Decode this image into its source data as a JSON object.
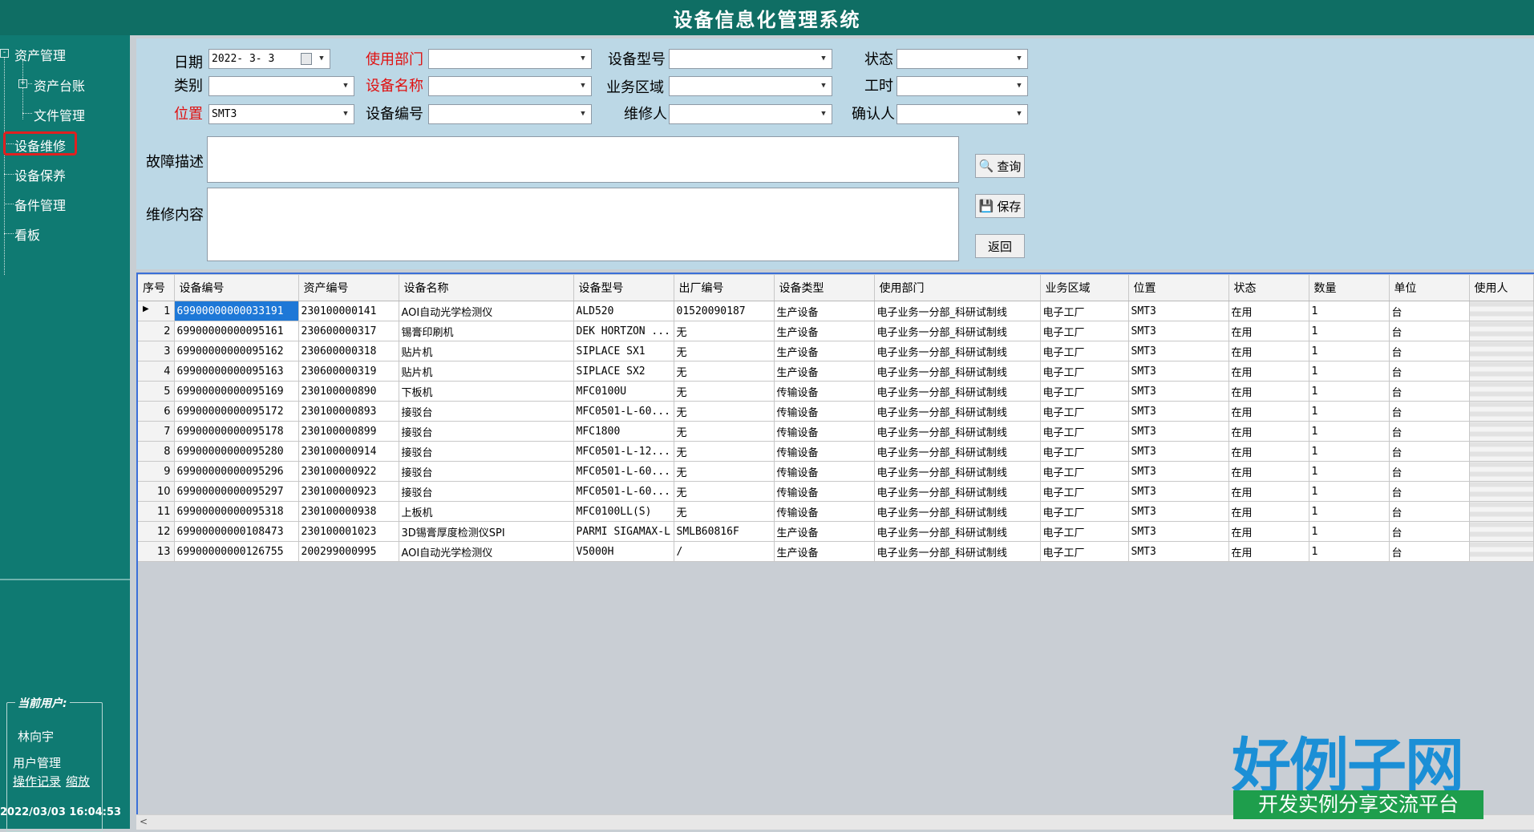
{
  "app": {
    "title": "设备信息化管理系统"
  },
  "sidebar": {
    "items": [
      {
        "label": "资产管理",
        "expander": "-"
      },
      {
        "label": "资产台账",
        "expander": "+"
      },
      {
        "label": "文件管理"
      },
      {
        "label": "设备维修",
        "selected": true
      },
      {
        "label": "设备保养"
      },
      {
        "label": "备件管理"
      },
      {
        "label": "看板"
      }
    ],
    "user_box": {
      "legend": "当前用户:",
      "user_name": "林向宇",
      "user_admin": "用户管理",
      "op_log": "操作记录",
      "zoom": "缩放"
    },
    "datetime": "2022/03/03 16:04:53"
  },
  "form": {
    "date": {
      "label": "日期",
      "value": "2022- 3- 3"
    },
    "dept": {
      "label": "使用部门",
      "value": ""
    },
    "model": {
      "label": "设备型号",
      "value": ""
    },
    "status": {
      "label": "状态",
      "value": ""
    },
    "category": {
      "label": "类别",
      "value": ""
    },
    "equip_name": {
      "label": "设备名称",
      "value": ""
    },
    "biz_area": {
      "label": "业务区域",
      "value": ""
    },
    "work_hours": {
      "label": "工时",
      "value": ""
    },
    "location": {
      "label": "位置",
      "value": "SMT3"
    },
    "equip_no": {
      "label": "设备编号",
      "value": ""
    },
    "repairer": {
      "label": "维修人",
      "value": ""
    },
    "confirmer": {
      "label": "确认人",
      "value": ""
    },
    "fault_desc": {
      "label": "故障描述",
      "value": ""
    },
    "repair_content": {
      "label": "维修内容",
      "value": ""
    },
    "buttons": {
      "query": "查询",
      "save": "保存",
      "back": "返回"
    }
  },
  "colors": {
    "titlebar": "#0f6e64",
    "sidebar": "#0f7a72",
    "form_bg": "#bcd8e6",
    "required_label": "#e01010",
    "selection": "#1e78d7"
  },
  "grid": {
    "columns": [
      "序号",
      "设备编号",
      "资产编号",
      "设备名称",
      "设备型号",
      "出厂编号",
      "设备类型",
      "使用部门",
      "业务区域",
      "位置",
      "状态",
      "数量",
      "单位",
      "使用人"
    ],
    "rows": [
      [
        "1",
        "69900000000033191",
        "230100000141",
        "AOI自动光学检测仪",
        "ALD520",
        "01520090187",
        "生产设备",
        "电子业务一分部_科研试制线",
        "电子工厂",
        "SMT3",
        "在用",
        "1",
        "台",
        ""
      ],
      [
        "2",
        "69900000000095161",
        "230600000317",
        "锡膏印刷机",
        "DEK HORTZON ...",
        "无",
        "生产设备",
        "电子业务一分部_科研试制线",
        "电子工厂",
        "SMT3",
        "在用",
        "1",
        "台",
        ""
      ],
      [
        "3",
        "69900000000095162",
        "230600000318",
        "贴片机",
        "SIPLACE SX1",
        "无",
        "生产设备",
        "电子业务一分部_科研试制线",
        "电子工厂",
        "SMT3",
        "在用",
        "1",
        "台",
        ""
      ],
      [
        "4",
        "69900000000095163",
        "230600000319",
        "贴片机",
        "SIPLACE SX2",
        "无",
        "生产设备",
        "电子业务一分部_科研试制线",
        "电子工厂",
        "SMT3",
        "在用",
        "1",
        "台",
        ""
      ],
      [
        "5",
        "69900000000095169",
        "230100000890",
        "下板机",
        "MFC0100U",
        "无",
        "传输设备",
        "电子业务一分部_科研试制线",
        "电子工厂",
        "SMT3",
        "在用",
        "1",
        "台",
        ""
      ],
      [
        "6",
        "69900000000095172",
        "230100000893",
        "接驳台",
        "MFC0501-L-60...",
        "无",
        "传输设备",
        "电子业务一分部_科研试制线",
        "电子工厂",
        "SMT3",
        "在用",
        "1",
        "台",
        ""
      ],
      [
        "7",
        "69900000000095178",
        "230100000899",
        "接驳台",
        "MFC1800",
        "无",
        "传输设备",
        "电子业务一分部_科研试制线",
        "电子工厂",
        "SMT3",
        "在用",
        "1",
        "台",
        ""
      ],
      [
        "8",
        "69900000000095280",
        "230100000914",
        "接驳台",
        "MFC0501-L-12...",
        "无",
        "传输设备",
        "电子业务一分部_科研试制线",
        "电子工厂",
        "SMT3",
        "在用",
        "1",
        "台",
        ""
      ],
      [
        "9",
        "69900000000095296",
        "230100000922",
        "接驳台",
        "MFC0501-L-60...",
        "无",
        "传输设备",
        "电子业务一分部_科研试制线",
        "电子工厂",
        "SMT3",
        "在用",
        "1",
        "台",
        ""
      ],
      [
        "10",
        "69900000000095297",
        "230100000923",
        "接驳台",
        "MFC0501-L-60...",
        "无",
        "传输设备",
        "电子业务一分部_科研试制线",
        "电子工厂",
        "SMT3",
        "在用",
        "1",
        "台",
        ""
      ],
      [
        "11",
        "69900000000095318",
        "230100000938",
        "上板机",
        "MFC0100LL(S)",
        "无",
        "传输设备",
        "电子业务一分部_科研试制线",
        "电子工厂",
        "SMT3",
        "在用",
        "1",
        "台",
        ""
      ],
      [
        "12",
        "69900000000108473",
        "230100001023",
        "3D锡膏厚度检测仪SPI",
        "PARMI SIGAMAX-L",
        "SMLB60816F",
        "生产设备",
        "电子业务一分部_科研试制线",
        "电子工厂",
        "SMT3",
        "在用",
        "1",
        "台",
        ""
      ],
      [
        "13",
        "69900000000126755",
        "200299000995",
        "AOI自动光学检测仪",
        "V5000H",
        "/",
        "生产设备",
        "电子业务一分部_科研试制线",
        "电子工厂",
        "SMT3",
        "在用",
        "1",
        "台",
        ""
      ]
    ]
  },
  "brand": {
    "main": "好例子网",
    "sub": "开发实例分享交流平台"
  }
}
